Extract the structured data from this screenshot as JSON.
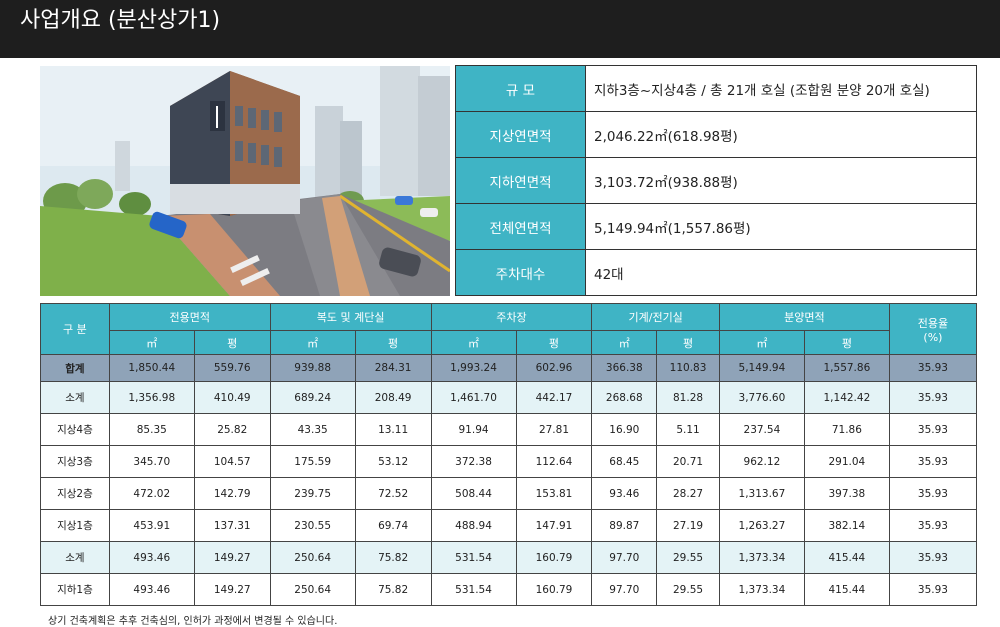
{
  "header": {
    "title": "사업개요 (분산상가1)"
  },
  "summary": [
    {
      "label": "규  모",
      "value": "지하3층~지상4층 / 총 21개 호실 (조합원 분양 20개 호실)"
    },
    {
      "label": "지상연면적",
      "value": "2,046.22㎡(618.98평)"
    },
    {
      "label": "지하연면적",
      "value": "3,103.72㎡(938.88평)"
    },
    {
      "label": "전체연면적",
      "value": "5,149.94㎡(1,557.86평)"
    },
    {
      "label": "주차대수",
      "value": "42대"
    }
  ],
  "table": {
    "division": "구  분",
    "groups": [
      "전용면적",
      "복도 및 계단실",
      "주차장",
      "기계/전기실",
      "분양면적"
    ],
    "ratio": "전용율\n(%)",
    "unit_m2": "㎡",
    "unit_py": "평",
    "rows": [
      {
        "label": "합계",
        "values": [
          "1,850.44",
          "559.76",
          "939.88",
          "284.31",
          "1,993.24",
          "602.96",
          "366.38",
          "110.83",
          "5,149.94",
          "1,557.86",
          "35.93"
        ]
      },
      {
        "label": "소계",
        "values": [
          "1,356.98",
          "410.49",
          "689.24",
          "208.49",
          "1,461.70",
          "442.17",
          "268.68",
          "81.28",
          "3,776.60",
          "1,142.42",
          "35.93"
        ]
      },
      {
        "label": "지상4층",
        "values": [
          "85.35",
          "25.82",
          "43.35",
          "13.11",
          "91.94",
          "27.81",
          "16.90",
          "5.11",
          "237.54",
          "71.86",
          "35.93"
        ]
      },
      {
        "label": "지상3층",
        "values": [
          "345.70",
          "104.57",
          "175.59",
          "53.12",
          "372.38",
          "112.64",
          "68.45",
          "20.71",
          "962.12",
          "291.04",
          "35.93"
        ]
      },
      {
        "label": "지상2층",
        "values": [
          "472.02",
          "142.79",
          "239.75",
          "72.52",
          "508.44",
          "153.81",
          "93.46",
          "28.27",
          "1,313.67",
          "397.38",
          "35.93"
        ]
      },
      {
        "label": "지상1층",
        "values": [
          "453.91",
          "137.31",
          "230.55",
          "69.74",
          "488.94",
          "147.91",
          "89.87",
          "27.19",
          "1,263.27",
          "382.14",
          "35.93"
        ]
      },
      {
        "label": "소계",
        "values": [
          "493.46",
          "149.27",
          "250.64",
          "75.82",
          "531.54",
          "160.79",
          "97.70",
          "29.55",
          "1,373.34",
          "415.44",
          "35.93"
        ]
      },
      {
        "label": "지하1층",
        "values": [
          "493.46",
          "149.27",
          "250.64",
          "75.82",
          "531.54",
          "160.79",
          "97.70",
          "29.55",
          "1,373.34",
          "415.44",
          "35.93"
        ]
      }
    ]
  },
  "footnote": "상기 건축계획은 추후 건축심의, 인허가 과정에서 변경될 수 있습니다."
}
